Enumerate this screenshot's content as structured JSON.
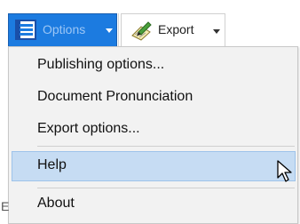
{
  "toolbar": {
    "options_label": "Options",
    "export_label": "Export"
  },
  "menu": {
    "items": [
      {
        "label": "Publishing options...",
        "state": "normal"
      },
      {
        "label": "Document Pronunciation",
        "state": "normal"
      },
      {
        "label": "Export options...",
        "state": "normal"
      },
      {
        "label": "Help",
        "state": "hover"
      },
      {
        "label": "About",
        "state": "normal"
      }
    ]
  },
  "background_fragment": "E",
  "colors": {
    "options_active_bg": "#1c7be0",
    "menu_bg": "#f2f2f2",
    "hover_bg": "#c6dcf3",
    "hover_border": "#9ec3ea"
  },
  "icons": {
    "options": "window-list-icon",
    "export": "pen-and-paper-icon",
    "cursor": "mouse-pointer-icon"
  }
}
